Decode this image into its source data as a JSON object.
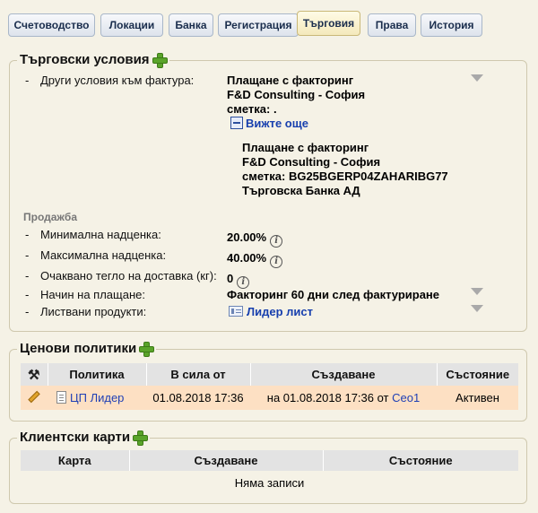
{
  "tabs": [
    {
      "label": "Счетоводство",
      "active": false
    },
    {
      "label": "Локации",
      "active": false
    },
    {
      "label": "Банка",
      "active": false
    },
    {
      "label": "Регистрация",
      "active": false
    },
    {
      "label": "Търговия",
      "active": true
    },
    {
      "label": "Права",
      "active": false
    },
    {
      "label": "История",
      "active": false
    }
  ],
  "trade_terms": {
    "legend": "Търговски условия",
    "invoice_terms_label": "Други условия към фактура:",
    "invoice_summary": {
      "line1": "Плащане с факторинг",
      "line2": "F&D Consulting - София",
      "line3": "сметка: ."
    },
    "see_more_label": "Вижте още",
    "invoice_details": {
      "line1": "Плащане с факторинг",
      "line2": "F&D Consulting - София",
      "line3": "сметка: BG25BGERP04ZAHARIBG77",
      "line4": "Търговска Банка АД"
    },
    "sales_section_label": "Продажба",
    "min_markup_label": "Минимална надценка:",
    "min_markup_value": "20.00%",
    "max_markup_label": "Максимална надценка:",
    "max_markup_value": "40.00%",
    "weight_label": "Очаквано тегло на доставка (кг):",
    "weight_value": "0",
    "payment_method_label": "Начин на плащане:",
    "payment_method_value": "Факторинг 60 дни след фактуриране",
    "listed_products_label": "Листвани продукти:",
    "listed_products_value": "Лидер лист"
  },
  "price_policies": {
    "legend": "Ценови политики",
    "columns": [
      "Политика",
      "В сила от",
      "Създаване",
      "Състояние"
    ],
    "row": {
      "policy": "ЦП Лидер",
      "effective_from": "01.08.2018 17:36",
      "created_prefix": "на 01.08.2018 17:36 от",
      "created_by": "Ceo1",
      "status": "Активен"
    }
  },
  "client_cards": {
    "legend": "Клиентски карти",
    "columns": [
      "Карта",
      "Създаване",
      "Състояние"
    ],
    "empty_text": "Няма записи"
  },
  "colors": {
    "accent_link": "#1f3fb5",
    "active_row": "#fde0c3",
    "add_icon": "#5aa42a"
  }
}
